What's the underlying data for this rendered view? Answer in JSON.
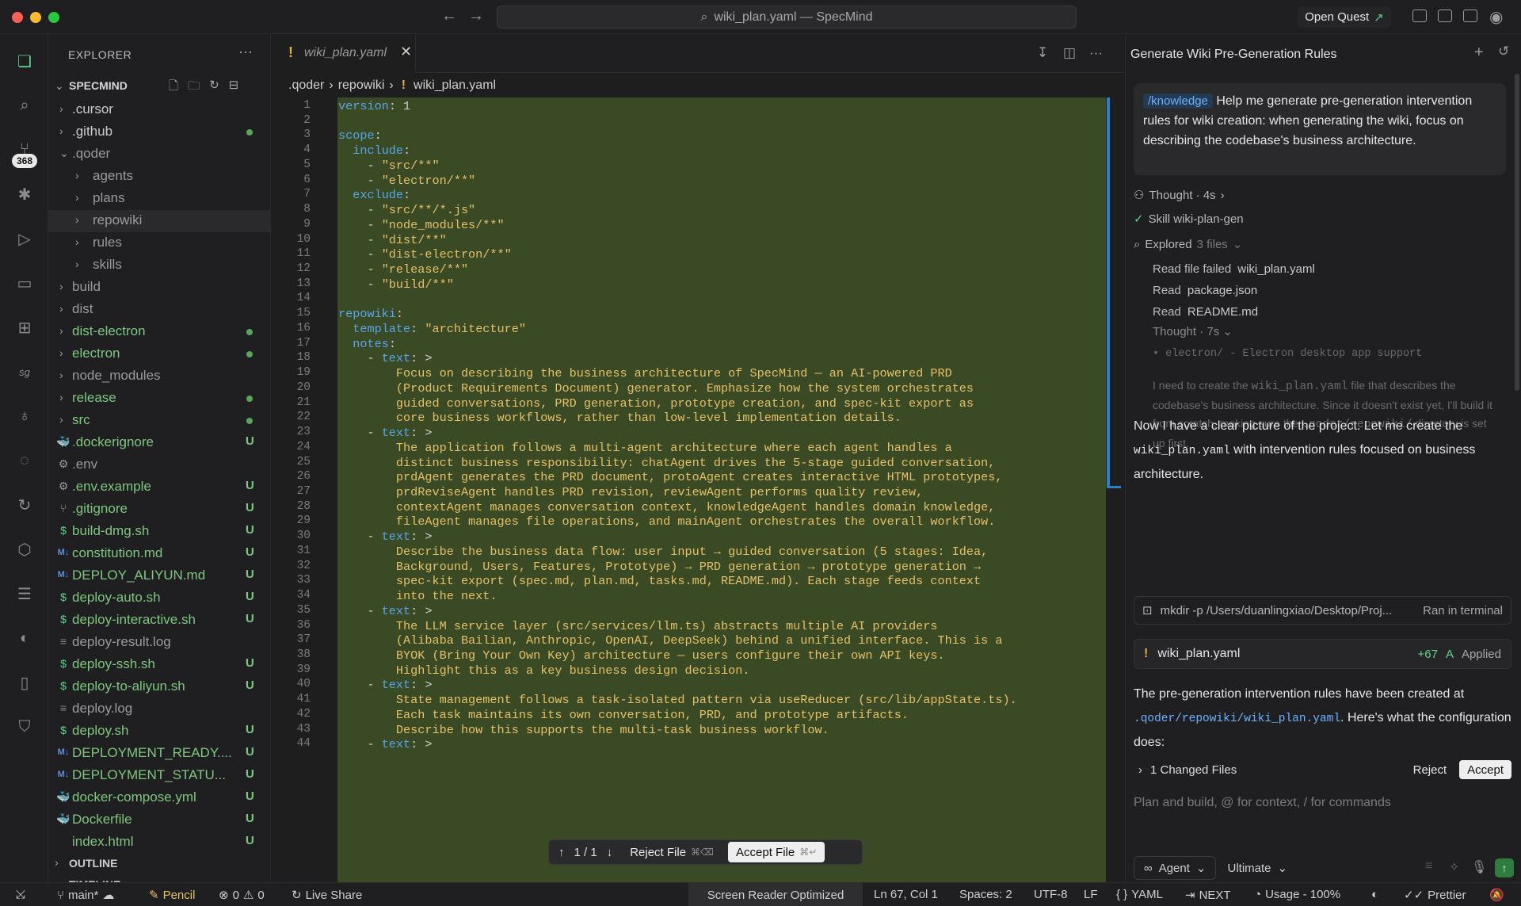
{
  "titlebar": {
    "search_text": "wiki_plan.yaml — SpecMind",
    "open_quest": "Open Quest"
  },
  "activity": {
    "badge": "368"
  },
  "sidebar": {
    "header": "EXPLORER",
    "project": "SPECMIND",
    "tree": [
      {
        "label": ".cursor",
        "depth": 1,
        "chev": "right",
        "icon": "",
        "color": "#cccccc",
        "status": ""
      },
      {
        "label": ".github",
        "depth": 1,
        "chev": "right",
        "icon": "",
        "color": "#cccccc",
        "status": "dot"
      },
      {
        "label": ".qoder",
        "depth": 1,
        "chev": "down",
        "icon": "",
        "color": "#9a9a9a",
        "status": ""
      },
      {
        "label": "agents",
        "depth": 2,
        "chev": "right",
        "icon": "",
        "color": "#9a9a9a",
        "status": ""
      },
      {
        "label": "plans",
        "depth": 2,
        "chev": "right",
        "icon": "",
        "color": "#9a9a9a",
        "status": ""
      },
      {
        "label": "repowiki",
        "depth": 2,
        "chev": "right",
        "icon": "",
        "color": "#9a9a9a",
        "status": "",
        "selected": true
      },
      {
        "label": "rules",
        "depth": 2,
        "chev": "right",
        "icon": "",
        "color": "#9a9a9a",
        "status": ""
      },
      {
        "label": "skills",
        "depth": 2,
        "chev": "right",
        "icon": "",
        "color": "#9a9a9a",
        "status": ""
      },
      {
        "label": "build",
        "depth": 1,
        "chev": "right",
        "icon": "",
        "color": "#9a9a9a",
        "status": ""
      },
      {
        "label": "dist",
        "depth": 1,
        "chev": "right",
        "icon": "",
        "color": "#9a9a9a",
        "status": ""
      },
      {
        "label": "dist-electron",
        "depth": 1,
        "chev": "right",
        "icon": "",
        "color": "#7fc77f",
        "status": "dot"
      },
      {
        "label": "electron",
        "depth": 1,
        "chev": "right",
        "icon": "",
        "color": "#7fc77f",
        "status": "dot"
      },
      {
        "label": "node_modules",
        "depth": 1,
        "chev": "right",
        "icon": "",
        "color": "#9a9a9a",
        "status": ""
      },
      {
        "label": "release",
        "depth": 1,
        "chev": "right",
        "icon": "",
        "color": "#7fc77f",
        "status": "dot"
      },
      {
        "label": "src",
        "depth": 1,
        "chev": "right",
        "icon": "",
        "color": "#7fc77f",
        "status": "dot"
      },
      {
        "label": ".dockerignore",
        "depth": 1,
        "chev": "",
        "icon": "docker",
        "color": "#7fc77f",
        "status": "U"
      },
      {
        "label": ".env",
        "depth": 1,
        "chev": "",
        "icon": "gear",
        "color": "#9a9a9a",
        "status": ""
      },
      {
        "label": ".env.example",
        "depth": 1,
        "chev": "",
        "icon": "gear",
        "color": "#7fc77f",
        "status": "U"
      },
      {
        "label": ".gitignore",
        "depth": 1,
        "chev": "",
        "icon": "git",
        "color": "#7fc77f",
        "status": "U"
      },
      {
        "label": "build-dmg.sh",
        "depth": 1,
        "chev": "",
        "icon": "dollar",
        "color": "#7fc77f",
        "status": "U"
      },
      {
        "label": "constitution.md",
        "depth": 1,
        "chev": "",
        "icon": "md",
        "color": "#7fc77f",
        "status": "U"
      },
      {
        "label": "DEPLOY_ALIYUN.md",
        "depth": 1,
        "chev": "",
        "icon": "md",
        "color": "#7fc77f",
        "status": "U"
      },
      {
        "label": "deploy-auto.sh",
        "depth": 1,
        "chev": "",
        "icon": "dollar",
        "color": "#7fc77f",
        "status": "U"
      },
      {
        "label": "deploy-interactive.sh",
        "depth": 1,
        "chev": "",
        "icon": "dollar",
        "color": "#7fc77f",
        "status": "U"
      },
      {
        "label": "deploy-result.log",
        "depth": 1,
        "chev": "",
        "icon": "lines",
        "color": "#9a9a9a",
        "status": ""
      },
      {
        "label": "deploy-ssh.sh",
        "depth": 1,
        "chev": "",
        "icon": "dollar",
        "color": "#7fc77f",
        "status": "U"
      },
      {
        "label": "deploy-to-aliyun.sh",
        "depth": 1,
        "chev": "",
        "icon": "dollar",
        "color": "#7fc77f",
        "status": "U"
      },
      {
        "label": "deploy.log",
        "depth": 1,
        "chev": "",
        "icon": "lines",
        "color": "#9a9a9a",
        "status": ""
      },
      {
        "label": "deploy.sh",
        "depth": 1,
        "chev": "",
        "icon": "dollar",
        "color": "#7fc77f",
        "status": "U"
      },
      {
        "label": "DEPLOYMENT_READY....",
        "depth": 1,
        "chev": "",
        "icon": "md",
        "color": "#7fc77f",
        "status": "U"
      },
      {
        "label": "DEPLOYMENT_STATU...",
        "depth": 1,
        "chev": "",
        "icon": "md",
        "color": "#7fc77f",
        "status": "U"
      },
      {
        "label": "docker-compose.yml",
        "depth": 1,
        "chev": "",
        "icon": "docker",
        "color": "#7fc77f",
        "status": "U"
      },
      {
        "label": "Dockerfile",
        "depth": 1,
        "chev": "",
        "icon": "docker",
        "color": "#7fc77f",
        "status": "U"
      },
      {
        "label": "index.html",
        "depth": 1,
        "chev": "",
        "icon": "",
        "color": "#7fc77f",
        "status": "U"
      }
    ],
    "outline": "OUTLINE",
    "timeline": "TIMELINE"
  },
  "editor": {
    "tab_name": "wiki_plan.yaml",
    "breadcrumb": [
      ".qoder",
      "repowiki",
      "wiki_plan.yaml"
    ],
    "lines": [
      [
        [
          "k",
          "version"
        ],
        [
          "p",
          ": 1"
        ]
      ],
      [],
      [
        [
          "k",
          "scope"
        ],
        [
          "p",
          ":"
        ]
      ],
      [
        [
          "p",
          "  "
        ],
        [
          "k",
          "include"
        ],
        [
          "p",
          ":"
        ]
      ],
      [
        [
          "p",
          "    - "
        ],
        [
          "s",
          "\"src/**\""
        ]
      ],
      [
        [
          "p",
          "    - "
        ],
        [
          "s",
          "\"electron/**\""
        ]
      ],
      [
        [
          "p",
          "  "
        ],
        [
          "k",
          "exclude"
        ],
        [
          "p",
          ":"
        ]
      ],
      [
        [
          "p",
          "    - "
        ],
        [
          "s",
          "\"src/**/*.js\""
        ]
      ],
      [
        [
          "p",
          "    - "
        ],
        [
          "s",
          "\"node_modules/**\""
        ]
      ],
      [
        [
          "p",
          "    - "
        ],
        [
          "s",
          "\"dist/**\""
        ]
      ],
      [
        [
          "p",
          "    - "
        ],
        [
          "s",
          "\"dist-electron/**\""
        ]
      ],
      [
        [
          "p",
          "    - "
        ],
        [
          "s",
          "\"release/**\""
        ]
      ],
      [
        [
          "p",
          "    - "
        ],
        [
          "s",
          "\"build/**\""
        ]
      ],
      [],
      [
        [
          "k",
          "repowiki"
        ],
        [
          "p",
          ":"
        ]
      ],
      [
        [
          "p",
          "  "
        ],
        [
          "k",
          "template"
        ],
        [
          "p",
          ": "
        ],
        [
          "s",
          "\"architecture\""
        ]
      ],
      [
        [
          "p",
          "  "
        ],
        [
          "k",
          "notes"
        ],
        [
          "p",
          ":"
        ]
      ],
      [
        [
          "p",
          "    - "
        ],
        [
          "k",
          "text"
        ],
        [
          "p",
          ": >"
        ]
      ],
      [
        [
          "s",
          "        Focus on describing the business architecture of SpecMind — an AI-powered PRD"
        ]
      ],
      [
        [
          "s",
          "        (Product Requirements Document) generator. Emphasize how the system orchestrates"
        ]
      ],
      [
        [
          "s",
          "        guided conversations, PRD generation, prototype creation, and spec-kit export as"
        ]
      ],
      [
        [
          "s",
          "        core business workflows, rather than low-level implementation details."
        ]
      ],
      [
        [
          "p",
          "    - "
        ],
        [
          "k",
          "text"
        ],
        [
          "p",
          ": >"
        ]
      ],
      [
        [
          "s",
          "        The application follows a multi-agent architecture where each agent handles a"
        ]
      ],
      [
        [
          "s",
          "        distinct business responsibility: chatAgent drives the 5-stage guided conversation,"
        ]
      ],
      [
        [
          "s",
          "        prdAgent generates the PRD document, protoAgent creates interactive HTML prototypes,"
        ]
      ],
      [
        [
          "s",
          "        prdReviseAgent handles PRD revision, reviewAgent performs quality review,"
        ]
      ],
      [
        [
          "s",
          "        contextAgent manages conversation context, knowledgeAgent handles domain knowledge,"
        ]
      ],
      [
        [
          "s",
          "        fileAgent manages file operations, and mainAgent orchestrates the overall workflow."
        ]
      ],
      [
        [
          "p",
          "    - "
        ],
        [
          "k",
          "text"
        ],
        [
          "p",
          ": >"
        ]
      ],
      [
        [
          "s",
          "        Describe the business data flow: user input → guided conversation (5 stages: Idea,"
        ]
      ],
      [
        [
          "s",
          "        Background, Users, Features, Prototype) → PRD generation → prototype generation →"
        ]
      ],
      [
        [
          "s",
          "        spec-kit export (spec.md, plan.md, tasks.md, README.md). Each stage feeds context"
        ]
      ],
      [
        [
          "s",
          "        into the next."
        ]
      ],
      [
        [
          "p",
          "    - "
        ],
        [
          "k",
          "text"
        ],
        [
          "p",
          ": >"
        ]
      ],
      [
        [
          "s",
          "        The LLM service layer (src/services/llm.ts) abstracts multiple AI providers"
        ]
      ],
      [
        [
          "s",
          "        (Alibaba Bailian, Anthropic, OpenAI, DeepSeek) behind a unified interface. This is a"
        ]
      ],
      [
        [
          "s",
          "        BYOK (Bring Your Own Key) architecture — users configure their own API keys."
        ]
      ],
      [
        [
          "s",
          "        Highlight this as a key business design decision."
        ]
      ],
      [
        [
          "p",
          "    - "
        ],
        [
          "k",
          "text"
        ],
        [
          "p",
          ": >"
        ]
      ],
      [
        [
          "s",
          "        State management follows a task-isolated pattern via useReducer (src/lib/appState.ts)."
        ]
      ],
      [
        [
          "s",
          "        Each task maintains its own conversation, PRD, and prototype artifacts."
        ]
      ],
      [
        [
          "s",
          "        Describe how this supports the multi-task business workflow."
        ]
      ],
      [
        [
          "p",
          "    - "
        ],
        [
          "k",
          "text"
        ],
        [
          "p",
          ": >"
        ]
      ]
    ],
    "diff_toolbar": {
      "nav": "1 / 1",
      "reject": "Reject File",
      "reject_kbd": "⌘⌫",
      "accept": "Accept File",
      "accept_kbd": "⌘↵"
    }
  },
  "panel": {
    "title": "Generate Wiki Pre-Generation Rules",
    "user_tag": "/knowledge",
    "user_msg": "Help me generate pre-generation intervention rules for wiki creation: when generating the wiki, focus on describing the codebase's business architecture.",
    "thought1": "Thought · 4s",
    "skill": "Skill wiki-plan-gen",
    "explored": "Explored",
    "explored_count": "3 files",
    "reads": [
      {
        "verb": "Read file failed",
        "file": "wiki_plan.yaml"
      },
      {
        "verb": "Read",
        "file": "package.json"
      },
      {
        "verb": "Read",
        "file": "README.md"
      }
    ],
    "thought2": "Thought · 7s",
    "fade_bullet": "electron/ - Electron desktop app support",
    "fade_p1": "I need to create the",
    "fade_code1": "wiki_plan.yaml",
    "fade_p2": "file that describes the codebase's business architecture. Since it doesn't exist yet, I'll build it from scratch, making sure the",
    "fade_code2": ".qoder/repowiki/",
    "fade_p3": "directory is set up first.",
    "msg1_a": "Now I have a clear picture of the project. Let me create the",
    "msg1_code": "wiki_plan.yaml",
    "msg1_b": "with intervention rules focused on business architecture.",
    "terminal_cmd": "mkdir -p /Users/duanlingxiao/Desktop/Proj...",
    "terminal_status": "Ran in terminal",
    "file_card": {
      "name": "wiki_plan.yaml",
      "added": "+67",
      "flag": "A",
      "status": "Applied"
    },
    "msg2_a": "The pre-generation intervention rules have been created at",
    "msg2_code": ".qoder/repowiki/wiki_plan.yaml",
    "msg2_b": ". Here's what the configuration does:",
    "changed_files": "1 Changed Files",
    "reject": "Reject",
    "accept": "Accept",
    "input_placeholder": "Plan and build, @ for context, / for commands",
    "agent": "Agent",
    "model": "Ultimate"
  },
  "status": {
    "branch": "main*",
    "pencil": "Pencil",
    "errors": "0",
    "warnings": "0",
    "live_share": "Live Share",
    "reader": "Screen Reader Optimized",
    "pos": "Ln 67, Col 1",
    "spaces": "Spaces: 2",
    "encoding": "UTF-8",
    "eol": "LF",
    "lang": "YAML",
    "next": "NEXT",
    "usage": "Usage - 100%",
    "prettier": "Prettier"
  },
  "colors": {
    "added_bg": "#3a4a25",
    "accent": "#2e7ec8",
    "git_green": "#7fc77f"
  }
}
